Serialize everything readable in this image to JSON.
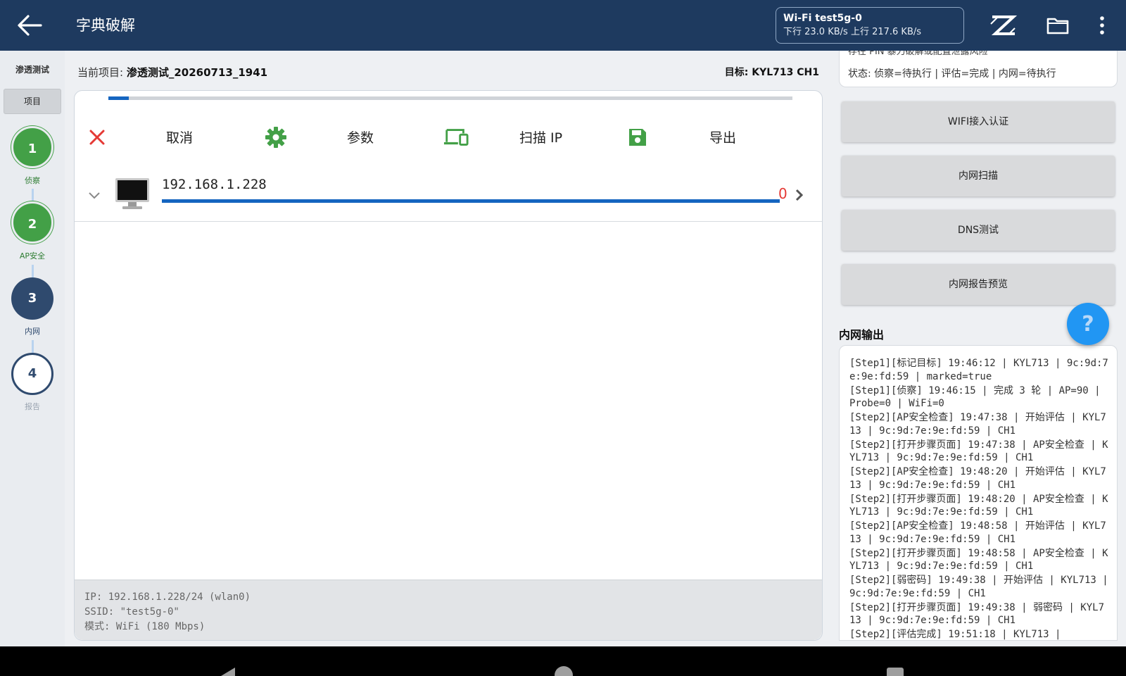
{
  "appbar": {
    "title": "字典破解",
    "wifi_name": "Wi-Fi test5g-0",
    "wifi_speed": "下行 23.0 KB/s 上行 217.6 KB/s"
  },
  "rail": {
    "title": "渗透测试",
    "tab": "项目",
    "steps": [
      {
        "num": "1",
        "label": "侦察",
        "state": "done"
      },
      {
        "num": "2",
        "label": "AP安全",
        "state": "done"
      },
      {
        "num": "3",
        "label": "内网",
        "state": "active"
      },
      {
        "num": "4",
        "label": "报告",
        "state": "todo"
      }
    ]
  },
  "main": {
    "project_label": "当前项目:",
    "project_name": "渗透测试_20260713_1941",
    "target": "目标: KYL713 CH1",
    "progress": 0.03,
    "toolbar": {
      "cancel": "取消",
      "params": "参数",
      "scan_ip": "扫描 IP",
      "export": "导出"
    },
    "host": {
      "ip": "192.168.1.228",
      "count": "0"
    },
    "info": {
      "ip_line": "IP: 192.168.1.228/24 (wlan0)",
      "ssid_line": "SSID: \"test5g-0\"",
      "mode_line": "模式: WiFi (180 Mbps)"
    }
  },
  "right": {
    "status_clipped": "存在 PIN 暴力破解或配置泄露风险",
    "status": "状态: 侦察=待执行 | 评估=完成 | 内网=待执行",
    "buttons": {
      "wifi_auth": "WIFI接入认证",
      "lan_scan": "内网扫描",
      "dns_test": "DNS测试",
      "report_preview": "内网报告预览"
    },
    "help": "?",
    "output_title": "内网输出",
    "log": [
      "[Step1][标记目标] 19:46:12 | KYL713 | 9c:9d:7e:9e:fd:59 | marked=true",
      "[Step1][侦察] 19:46:15 | 完成 3 轮 | AP=90 | Probe=0 | WiFi=0",
      "[Step2][AP安全检查] 19:47:38 | 开始评估 | KYL713 | 9c:9d:7e:9e:fd:59 | CH1",
      "[Step2][打开步骤页面] 19:47:38 | AP安全检查 | KYL713 | 9c:9d:7e:9e:fd:59 | CH1",
      "[Step2][AP安全检查] 19:48:20 | 开始评估 | KYL713 | 9c:9d:7e:9e:fd:59 | CH1",
      "[Step2][打开步骤页面] 19:48:20 | AP安全检查 | KYL713 | 9c:9d:7e:9e:fd:59 | CH1",
      "[Step2][AP安全检查] 19:48:58 | 开始评估 | KYL713 | 9c:9d:7e:9e:fd:59 | CH1",
      "[Step2][打开步骤页面] 19:48:58 | AP安全检查 | KYL713 | 9c:9d:7e:9e:fd:59 | CH1",
      "[Step2][弱密码] 19:49:38 | 开始评估 | KYL713 | 9c:9d:7e:9e:fd:59 | CH1",
      "[Step2][打开步骤页面] 19:49:38 | 弱密码 | KYL713 | 9c:9d:7e:9e:fd:59 | CH1",
      "[Step2][评估完成] 19:51:18 | KYL713 |"
    ]
  },
  "colors": {
    "appbar": "#1e3a5f",
    "accent_blue": "#1565c0",
    "green": "#43a047",
    "red": "#e53935",
    "help_blue": "#2196f3"
  }
}
